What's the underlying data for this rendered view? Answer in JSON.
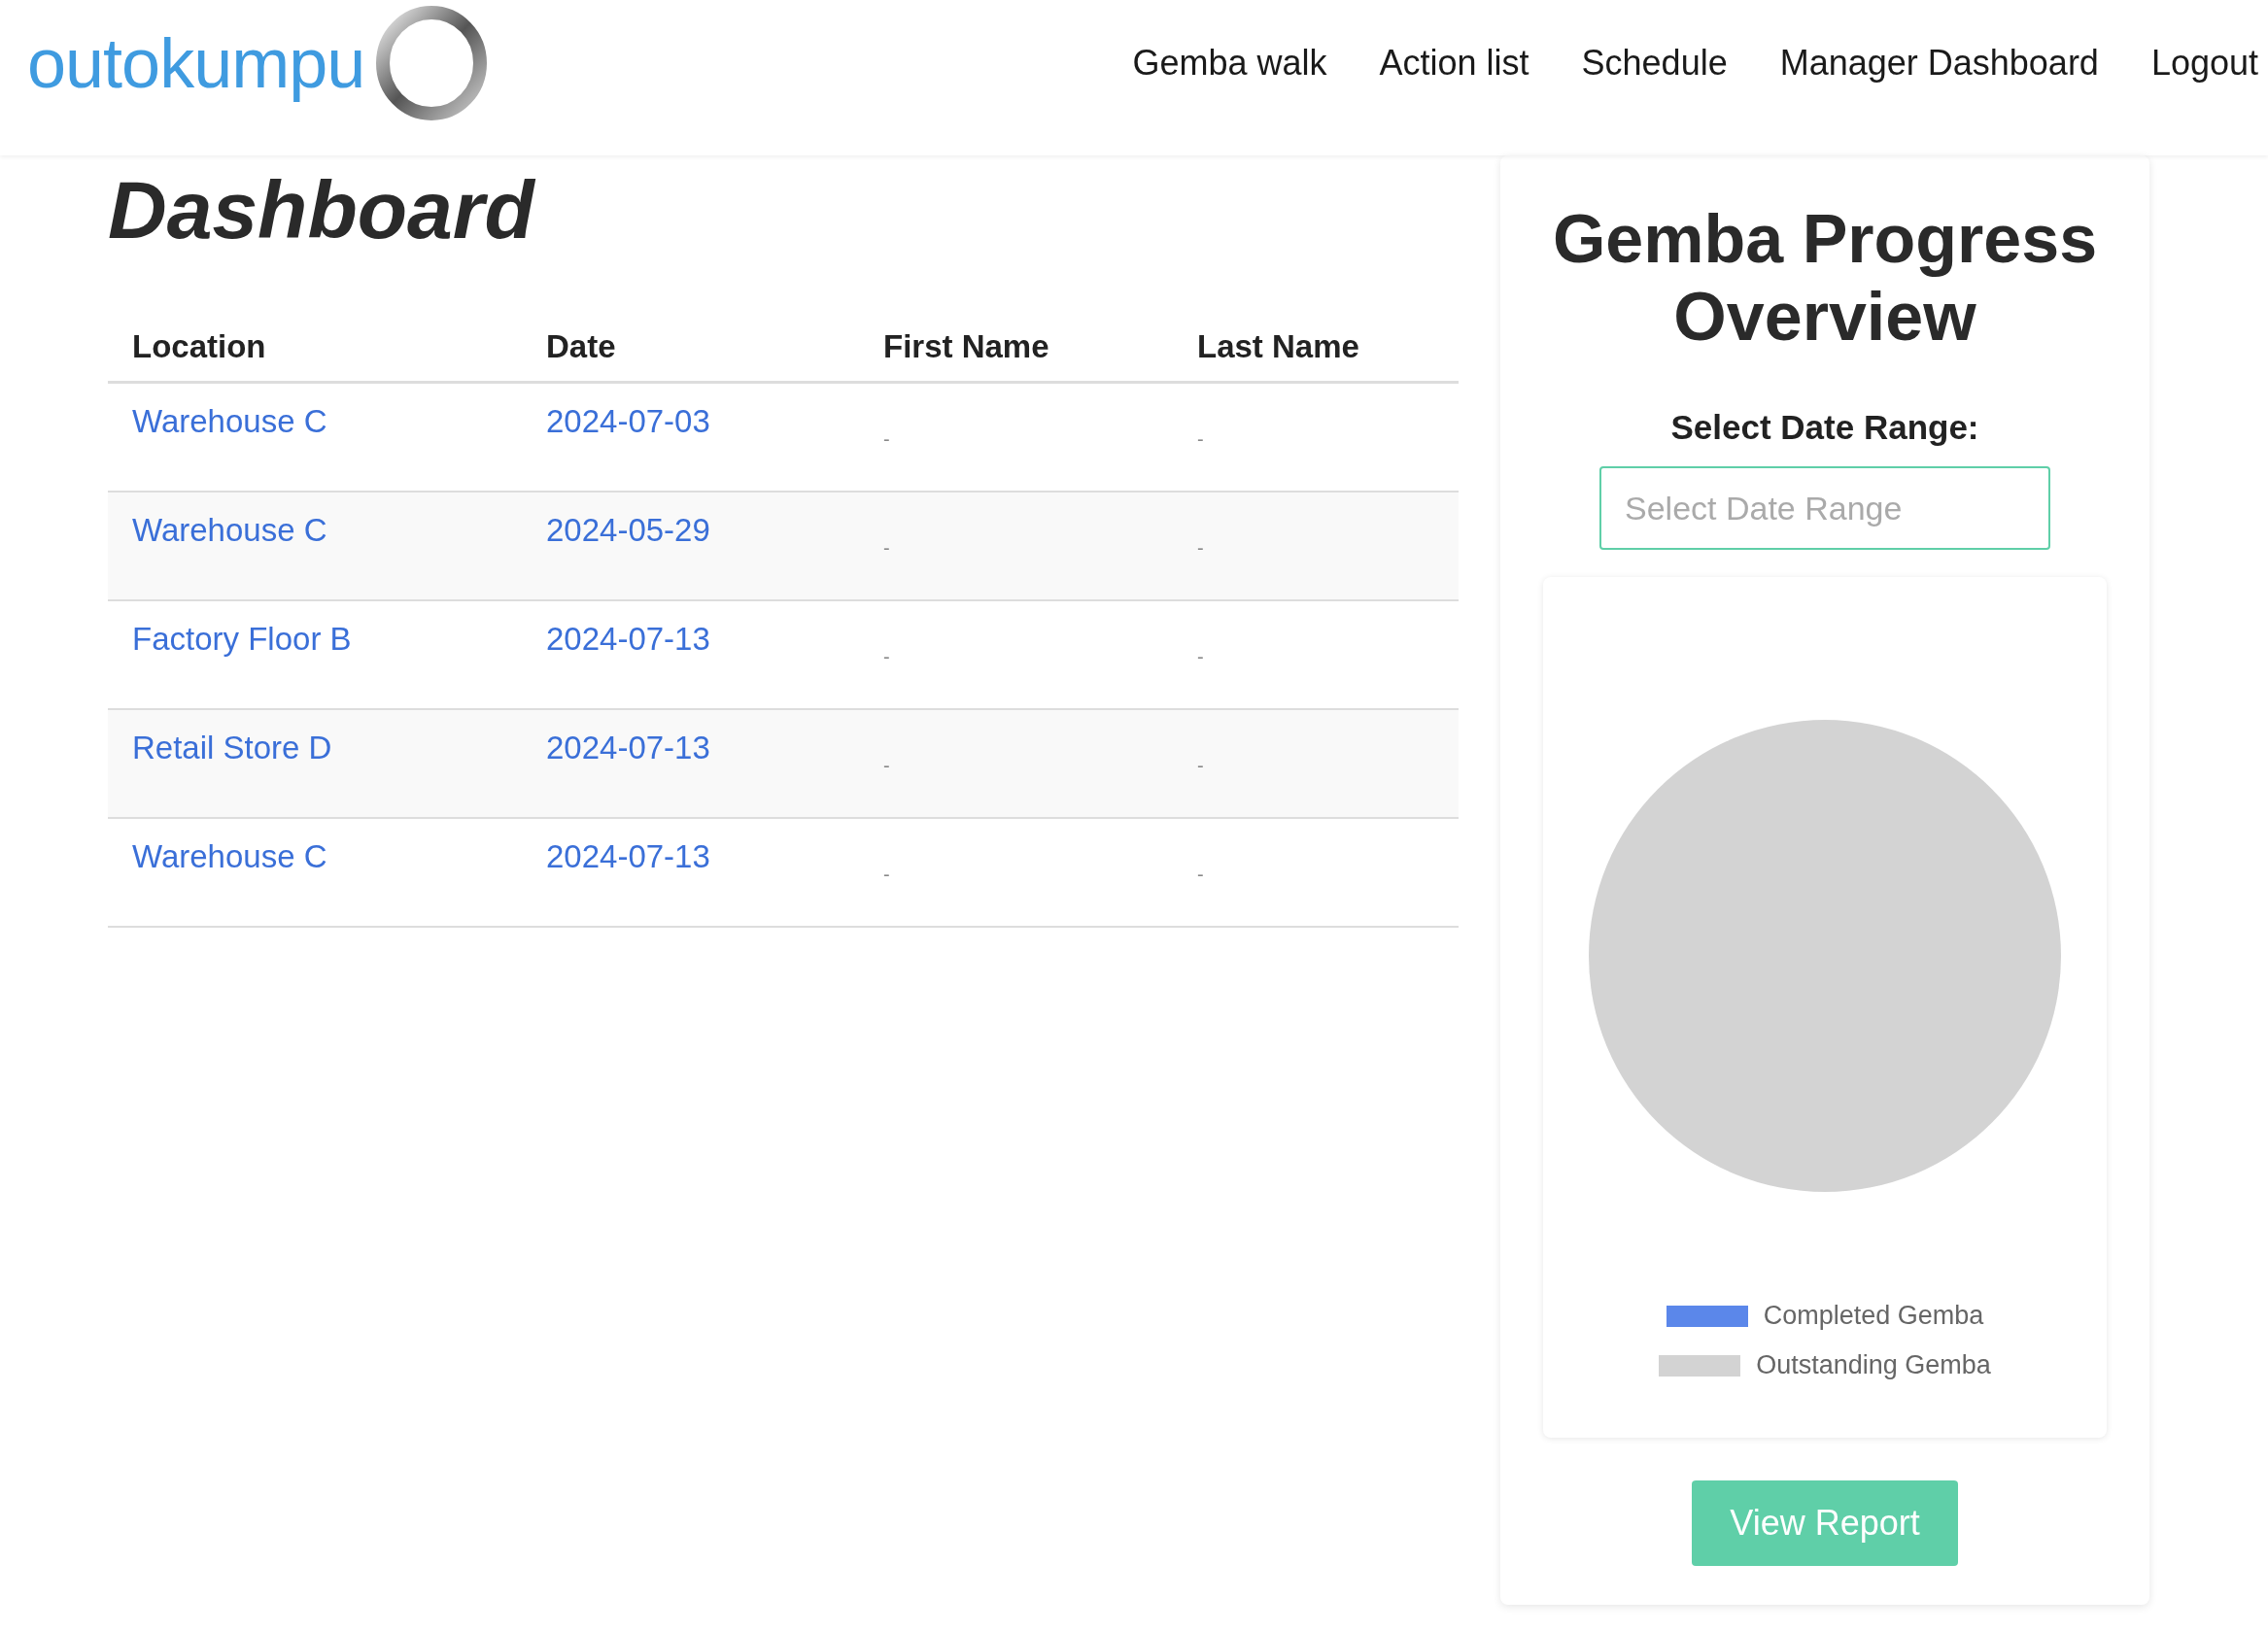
{
  "header": {
    "logo_text": "outokumpu",
    "nav": [
      "Gemba walk",
      "Action list",
      "Schedule",
      "Manager Dashboard",
      "Logout"
    ]
  },
  "page_title": "Dashboard",
  "table": {
    "columns": [
      "Location",
      "Date",
      "First Name",
      "Last Name"
    ],
    "rows": [
      {
        "location": "Warehouse C",
        "date": "2024-07-03",
        "first_name": "-",
        "last_name": "-"
      },
      {
        "location": "Warehouse C",
        "date": "2024-05-29",
        "first_name": "-",
        "last_name": "-"
      },
      {
        "location": "Factory Floor B",
        "date": "2024-07-13",
        "first_name": "-",
        "last_name": "-"
      },
      {
        "location": "Retail Store D",
        "date": "2024-07-13",
        "first_name": "-",
        "last_name": "-"
      },
      {
        "location": "Warehouse C",
        "date": "2024-07-13",
        "first_name": "-",
        "last_name": "-"
      }
    ]
  },
  "progress": {
    "title": "Gemba Progress Overview",
    "range_label": "Select Date Range:",
    "range_field": {
      "placeholder": "Select Date Range"
    },
    "chart_data": {
      "type": "pie",
      "categories": [
        "Completed Gemba",
        "Outstanding Gemba"
      ],
      "values": [
        0,
        1
      ],
      "colors": [
        "#5b87ea",
        "#d3d3d3"
      ]
    },
    "button": "View Report"
  }
}
